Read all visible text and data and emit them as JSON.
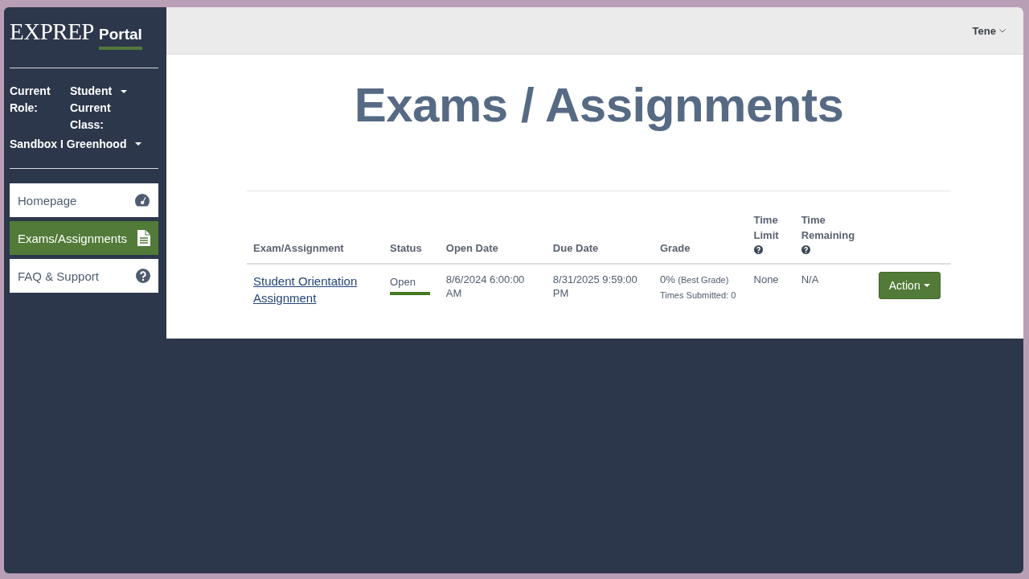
{
  "sidebar": {
    "logo": {
      "brand": "EXPREP",
      "product": "Portal"
    },
    "role": {
      "label": "Current Role:",
      "value": "Student"
    },
    "class": {
      "label": "Current Class:",
      "value": "Sandbox I Greenhood"
    },
    "nav": [
      {
        "label": "Homepage",
        "selected": false
      },
      {
        "label": "Exams/Assignments",
        "selected": true
      },
      {
        "label": "FAQ & Support",
        "selected": false
      }
    ]
  },
  "header": {
    "user": "Tene"
  },
  "page_title": "Exams / Assignments",
  "table": {
    "columns": [
      {
        "label": "Exam/Assignment",
        "help": false
      },
      {
        "label": "Status",
        "help": false
      },
      {
        "label": "Open Date",
        "help": false
      },
      {
        "label": "Due Date",
        "help": false
      },
      {
        "label": "Grade",
        "help": false
      },
      {
        "label": "Time Limit",
        "help": true
      },
      {
        "label": "Time Remaining",
        "help": true
      }
    ],
    "rows": [
      {
        "name": "Student Orientation Assignment",
        "status": "Open",
        "open_date": "8/6/2024 6:00:00 AM",
        "due_date": "8/31/2025 9:59:00 PM",
        "grade": "0%",
        "grade_note": "(Best Grade)",
        "submitted": "Times Submitted: 0",
        "time_limit": "None",
        "time_remaining": "N/A",
        "action": "Action"
      }
    ]
  }
}
